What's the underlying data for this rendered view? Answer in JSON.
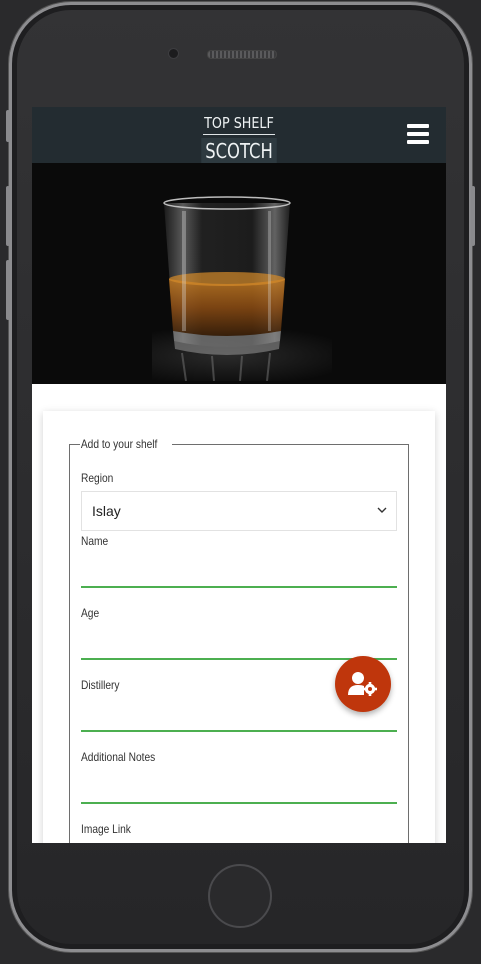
{
  "app": {
    "logo_top": "TOP SHELF",
    "logo_bottom": "SCOTCH"
  },
  "hero": {
    "alt": "glass of whisky"
  },
  "form": {
    "legend": "Add to your shelf",
    "region_label": "Region",
    "region_value": "Islay",
    "name_label": "Name",
    "age_label": "Age",
    "distillery_label": "Distillery",
    "notes_label": "Additional Notes",
    "image_label": "Image Link"
  },
  "fab": {
    "icon": "user-cog-icon"
  },
  "colors": {
    "navbar": "#232c31",
    "input_underline": "#4caf50",
    "fab": "#bf360c"
  }
}
